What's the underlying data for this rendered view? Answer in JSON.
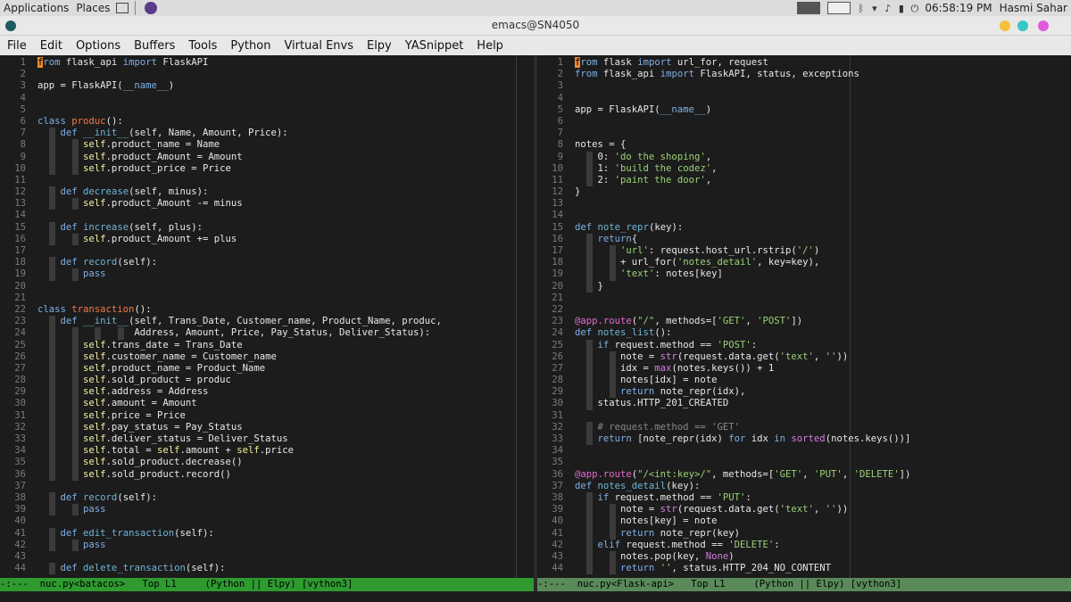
{
  "panel": {
    "applications": "Applications",
    "places": "Places",
    "clock": "06:58:19 PM",
    "user": "Hasmi Sahar"
  },
  "window": {
    "title": "emacs@SN4050"
  },
  "menu": [
    "File",
    "Edit",
    "Options",
    "Buffers",
    "Tools",
    "Python",
    "Virtual Envs",
    "Elpy",
    "YASnippet",
    "Help"
  ],
  "left_pane": {
    "modeline": "-:---  nuc.py<batacos>   Top L1     (Python || Elpy) [vython3]",
    "lines": [
      [
        [
          "cursor",
          "f"
        ],
        [
          "kw",
          "rom"
        ],
        [
          "plain",
          " flask_api "
        ],
        [
          "kw",
          "import"
        ],
        [
          "plain",
          " FlaskAPI"
        ]
      ],
      [],
      [
        [
          "plain",
          "app = FlaskAPI("
        ],
        [
          "dunder",
          "__name__"
        ],
        [
          "plain",
          ")"
        ]
      ],
      [],
      [],
      [
        [
          "kw",
          "class"
        ],
        [
          "plain",
          " "
        ],
        [
          "cls",
          "produc"
        ],
        [
          "plain",
          "():"
        ]
      ],
      [
        [
          "plain",
          "    "
        ],
        [
          "kw",
          "def"
        ],
        [
          "plain",
          " "
        ],
        [
          "fn",
          "__init__"
        ],
        [
          "plain",
          "(self, Name, Amount, Price):"
        ]
      ],
      [
        [
          "plain",
          "        "
        ],
        [
          "self",
          "self"
        ],
        [
          "plain",
          ".product_name = Name"
        ]
      ],
      [
        [
          "plain",
          "        "
        ],
        [
          "self",
          "self"
        ],
        [
          "plain",
          ".product_Amount = Amount"
        ]
      ],
      [
        [
          "plain",
          "        "
        ],
        [
          "self",
          "self"
        ],
        [
          "plain",
          ".product_price = Price"
        ]
      ],
      [],
      [
        [
          "plain",
          "    "
        ],
        [
          "kw",
          "def"
        ],
        [
          "plain",
          " "
        ],
        [
          "fn",
          "decrease"
        ],
        [
          "plain",
          "(self, minus):"
        ]
      ],
      [
        [
          "plain",
          "        "
        ],
        [
          "self",
          "self"
        ],
        [
          "plain",
          ".product_Amount -= minus"
        ]
      ],
      [],
      [
        [
          "plain",
          "    "
        ],
        [
          "kw",
          "def"
        ],
        [
          "plain",
          " "
        ],
        [
          "fn",
          "increase"
        ],
        [
          "plain",
          "(self, plus):"
        ]
      ],
      [
        [
          "plain",
          "        "
        ],
        [
          "self",
          "self"
        ],
        [
          "plain",
          ".product_Amount += plus"
        ]
      ],
      [],
      [
        [
          "plain",
          "    "
        ],
        [
          "kw",
          "def"
        ],
        [
          "plain",
          " "
        ],
        [
          "fn",
          "record"
        ],
        [
          "plain",
          "(self):"
        ]
      ],
      [
        [
          "plain",
          "        "
        ],
        [
          "kw",
          "pass"
        ]
      ],
      [],
      [],
      [
        [
          "kw",
          "class"
        ],
        [
          "plain",
          " "
        ],
        [
          "cls",
          "transaction"
        ],
        [
          "plain",
          "():"
        ]
      ],
      [
        [
          "plain",
          "    "
        ],
        [
          "kw",
          "def"
        ],
        [
          "plain",
          " "
        ],
        [
          "fn",
          "__init__"
        ],
        [
          "plain",
          "(self, Trans_Date, Customer_name, Product_Name, produc,"
        ]
      ],
      [
        [
          "plain",
          "                 Address, Amount, Price, Pay_Status, Deliver_Status):"
        ]
      ],
      [
        [
          "plain",
          "        "
        ],
        [
          "self",
          "self"
        ],
        [
          "plain",
          ".trans_date = Trans_Date"
        ]
      ],
      [
        [
          "plain",
          "        "
        ],
        [
          "self",
          "self"
        ],
        [
          "plain",
          ".customer_name = Customer_name"
        ]
      ],
      [
        [
          "plain",
          "        "
        ],
        [
          "self",
          "self"
        ],
        [
          "plain",
          ".product_name = Product_Name"
        ]
      ],
      [
        [
          "plain",
          "        "
        ],
        [
          "self",
          "self"
        ],
        [
          "plain",
          ".sold_product = produc"
        ]
      ],
      [
        [
          "plain",
          "        "
        ],
        [
          "self",
          "self"
        ],
        [
          "plain",
          ".address = Address"
        ]
      ],
      [
        [
          "plain",
          "        "
        ],
        [
          "self",
          "self"
        ],
        [
          "plain",
          ".amount = Amount"
        ]
      ],
      [
        [
          "plain",
          "        "
        ],
        [
          "self",
          "self"
        ],
        [
          "plain",
          ".price = Price"
        ]
      ],
      [
        [
          "plain",
          "        "
        ],
        [
          "self",
          "self"
        ],
        [
          "plain",
          ".pay_status = Pay_Status"
        ]
      ],
      [
        [
          "plain",
          "        "
        ],
        [
          "self",
          "self"
        ],
        [
          "plain",
          ".deliver_status = Deliver_Status"
        ]
      ],
      [
        [
          "plain",
          "        "
        ],
        [
          "self",
          "self"
        ],
        [
          "plain",
          ".total = "
        ],
        [
          "self",
          "self"
        ],
        [
          "plain",
          ".amount + "
        ],
        [
          "self",
          "self"
        ],
        [
          "plain",
          ".price"
        ]
      ],
      [
        [
          "plain",
          "        "
        ],
        [
          "self",
          "self"
        ],
        [
          "plain",
          ".sold_product.decrease()"
        ]
      ],
      [
        [
          "plain",
          "        "
        ],
        [
          "self",
          "self"
        ],
        [
          "plain",
          ".sold_product.record()"
        ]
      ],
      [],
      [
        [
          "plain",
          "    "
        ],
        [
          "kw",
          "def"
        ],
        [
          "plain",
          " "
        ],
        [
          "fn",
          "record"
        ],
        [
          "plain",
          "(self):"
        ]
      ],
      [
        [
          "plain",
          "        "
        ],
        [
          "kw",
          "pass"
        ]
      ],
      [],
      [
        [
          "plain",
          "    "
        ],
        [
          "kw",
          "def"
        ],
        [
          "plain",
          " "
        ],
        [
          "fn",
          "edit_transaction"
        ],
        [
          "plain",
          "(self):"
        ]
      ],
      [
        [
          "plain",
          "        "
        ],
        [
          "kw",
          "pass"
        ]
      ],
      [],
      [
        [
          "plain",
          "    "
        ],
        [
          "kw",
          "def"
        ],
        [
          "plain",
          " "
        ],
        [
          "fn",
          "delete_transaction"
        ],
        [
          "plain",
          "(self):"
        ]
      ]
    ],
    "guides": [
      [],
      [],
      [],
      [],
      [],
      [],
      [
        0
      ],
      [
        0,
        1
      ],
      [
        0,
        1
      ],
      [
        0,
        1
      ],
      [],
      [
        0
      ],
      [
        0,
        1
      ],
      [],
      [
        0
      ],
      [
        0,
        1
      ],
      [],
      [
        0
      ],
      [
        0,
        1
      ],
      [],
      [],
      [],
      [
        0
      ],
      [
        0,
        1,
        2,
        3
      ],
      [
        0,
        1
      ],
      [
        0,
        1
      ],
      [
        0,
        1
      ],
      [
        0,
        1
      ],
      [
        0,
        1
      ],
      [
        0,
        1
      ],
      [
        0,
        1
      ],
      [
        0,
        1
      ],
      [
        0,
        1
      ],
      [
        0,
        1
      ],
      [
        0,
        1
      ],
      [
        0,
        1
      ],
      [],
      [
        0
      ],
      [
        0,
        1
      ],
      [],
      [
        0
      ],
      [
        0,
        1
      ],
      [],
      [
        0
      ]
    ]
  },
  "right_pane": {
    "modeline": "-:---  nuc.py<Flask-api>   Top L1     (Python || Elpy) [vython3]",
    "lines": [
      [
        [
          "cursor",
          "f"
        ],
        [
          "kw",
          "rom"
        ],
        [
          "plain",
          " flask "
        ],
        [
          "kw",
          "import"
        ],
        [
          "plain",
          " url_for, request"
        ]
      ],
      [
        [
          "kw",
          "from"
        ],
        [
          "plain",
          " flask_api "
        ],
        [
          "kw",
          "import"
        ],
        [
          "plain",
          " FlaskAPI, status, exceptions"
        ]
      ],
      [],
      [],
      [
        [
          "plain",
          "app = FlaskAPI("
        ],
        [
          "dunder",
          "__name__"
        ],
        [
          "plain",
          ")"
        ]
      ],
      [],
      [],
      [
        [
          "plain",
          "notes = {"
        ]
      ],
      [
        [
          "plain",
          "    0: "
        ],
        [
          "str",
          "'do the shoping'"
        ],
        [
          "plain",
          ","
        ]
      ],
      [
        [
          "plain",
          "    1: "
        ],
        [
          "str",
          "'build the codez'"
        ],
        [
          "plain",
          ","
        ]
      ],
      [
        [
          "plain",
          "    2: "
        ],
        [
          "str",
          "'paint the door'"
        ],
        [
          "plain",
          ","
        ]
      ],
      [
        [
          "plain",
          "}"
        ]
      ],
      [],
      [],
      [
        [
          "kw",
          "def"
        ],
        [
          "plain",
          " "
        ],
        [
          "fn",
          "note_repr"
        ],
        [
          "plain",
          "(key):"
        ]
      ],
      [
        [
          "plain",
          "    "
        ],
        [
          "kw",
          "return"
        ],
        [
          "plain",
          "{"
        ]
      ],
      [
        [
          "plain",
          "        "
        ],
        [
          "str",
          "'url'"
        ],
        [
          "plain",
          ": request.host_url.rstrip("
        ],
        [
          "str",
          "'/'"
        ],
        [
          "plain",
          ")"
        ]
      ],
      [
        [
          "plain",
          "        + url_for("
        ],
        [
          "str",
          "'notes_detail'"
        ],
        [
          "plain",
          ", key=key),"
        ]
      ],
      [
        [
          "plain",
          "        "
        ],
        [
          "str",
          "'text'"
        ],
        [
          "plain",
          ": notes[key]"
        ]
      ],
      [
        [
          "plain",
          "    }"
        ]
      ],
      [],
      [],
      [
        [
          "dec",
          "@app.route"
        ],
        [
          "plain",
          "("
        ],
        [
          "str",
          "\"/\""
        ],
        [
          "plain",
          ", methods=["
        ],
        [
          "str",
          "'GET'"
        ],
        [
          "plain",
          ", "
        ],
        [
          "str",
          "'POST'"
        ],
        [
          "plain",
          "])"
        ]
      ],
      [
        [
          "kw",
          "def"
        ],
        [
          "plain",
          " "
        ],
        [
          "fn",
          "notes_list"
        ],
        [
          "plain",
          "():"
        ]
      ],
      [
        [
          "plain",
          "    "
        ],
        [
          "kw",
          "if"
        ],
        [
          "plain",
          " request.method == "
        ],
        [
          "str",
          "'POST'"
        ],
        [
          "plain",
          ":"
        ]
      ],
      [
        [
          "plain",
          "        note = "
        ],
        [
          "bi",
          "str"
        ],
        [
          "plain",
          "(request.data.get("
        ],
        [
          "str",
          "'text'"
        ],
        [
          "plain",
          ", "
        ],
        [
          "str",
          "''"
        ],
        [
          "plain",
          "))"
        ]
      ],
      [
        [
          "plain",
          "        idx = "
        ],
        [
          "bi",
          "max"
        ],
        [
          "plain",
          "(notes.keys()) + 1"
        ]
      ],
      [
        [
          "plain",
          "        notes[idx] = note"
        ]
      ],
      [
        [
          "plain",
          "        "
        ],
        [
          "kw",
          "return"
        ],
        [
          "plain",
          " note_repr(idx),"
        ]
      ],
      [
        [
          "plain",
          "    status.HTTP_201_CREATED"
        ]
      ],
      [],
      [
        [
          "plain",
          "    "
        ],
        [
          "cmt",
          "# request.method == 'GET'"
        ]
      ],
      [
        [
          "plain",
          "    "
        ],
        [
          "kw",
          "return"
        ],
        [
          "plain",
          " [note_repr(idx) "
        ],
        [
          "kw",
          "for"
        ],
        [
          "plain",
          " idx "
        ],
        [
          "kw",
          "in"
        ],
        [
          "plain",
          " "
        ],
        [
          "bi",
          "sorted"
        ],
        [
          "plain",
          "(notes.keys())]"
        ]
      ],
      [],
      [],
      [
        [
          "dec",
          "@app.route"
        ],
        [
          "plain",
          "("
        ],
        [
          "str",
          "\"/<int:key>/\""
        ],
        [
          "plain",
          ", methods=["
        ],
        [
          "str",
          "'GET'"
        ],
        [
          "plain",
          ", "
        ],
        [
          "str",
          "'PUT'"
        ],
        [
          "plain",
          ", "
        ],
        [
          "str",
          "'DELETE'"
        ],
        [
          "plain",
          "])"
        ]
      ],
      [
        [
          "kw",
          "def"
        ],
        [
          "plain",
          " "
        ],
        [
          "fn",
          "notes_detail"
        ],
        [
          "plain",
          "(key):"
        ]
      ],
      [
        [
          "plain",
          "    "
        ],
        [
          "kw",
          "if"
        ],
        [
          "plain",
          " request.method == "
        ],
        [
          "str",
          "'PUT'"
        ],
        [
          "plain",
          ":"
        ]
      ],
      [
        [
          "plain",
          "        note = "
        ],
        [
          "bi",
          "str"
        ],
        [
          "plain",
          "(request.data.get("
        ],
        [
          "str",
          "'text'"
        ],
        [
          "plain",
          ", "
        ],
        [
          "str",
          "''"
        ],
        [
          "plain",
          "))"
        ]
      ],
      [
        [
          "plain",
          "        notes[key] = note"
        ]
      ],
      [
        [
          "plain",
          "        "
        ],
        [
          "kw",
          "return"
        ],
        [
          "plain",
          " note_repr(key)"
        ]
      ],
      [
        [
          "plain",
          "    "
        ],
        [
          "kw",
          "elif"
        ],
        [
          "plain",
          " request.method == "
        ],
        [
          "str",
          "'DELETE'"
        ],
        [
          "plain",
          ":"
        ]
      ],
      [
        [
          "plain",
          "        notes.pop(key, "
        ],
        [
          "bi",
          "None"
        ],
        [
          "plain",
          ")"
        ]
      ],
      [
        [
          "plain",
          "        "
        ],
        [
          "kw",
          "return"
        ],
        [
          "plain",
          " "
        ],
        [
          "str",
          "''"
        ],
        [
          "plain",
          ", status.HTTP_204_NO_CONTENT"
        ]
      ]
    ],
    "guides": [
      [],
      [],
      [],
      [],
      [],
      [],
      [],
      [],
      [
        0
      ],
      [
        0
      ],
      [
        0
      ],
      [],
      [],
      [],
      [],
      [
        0
      ],
      [
        0,
        1
      ],
      [
        0,
        1
      ],
      [
        0,
        1
      ],
      [
        0
      ],
      [],
      [],
      [],
      [],
      [
        0
      ],
      [
        0,
        1
      ],
      [
        0,
        1
      ],
      [
        0,
        1
      ],
      [
        0,
        1
      ],
      [
        0
      ],
      [],
      [
        0
      ],
      [
        0
      ],
      [],
      [],
      [],
      [],
      [
        0
      ],
      [
        0,
        1
      ],
      [
        0,
        1
      ],
      [
        0,
        1
      ],
      [
        0
      ],
      [
        0,
        1
      ],
      [
        0,
        1
      ]
    ]
  }
}
